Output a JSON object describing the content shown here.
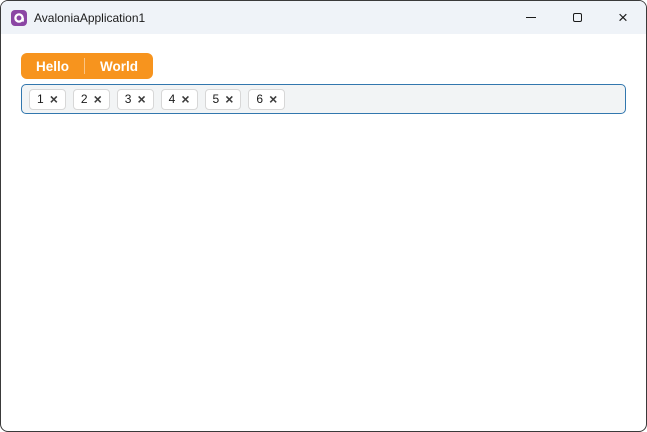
{
  "window": {
    "title": "AvaloniaApplication1",
    "app_icon": "avalonia-logo-icon",
    "controls": {
      "minimize_icon": "minimize-icon",
      "maximize_icon": "maximize-icon",
      "close_icon": "close-icon",
      "close_glyph": "×"
    }
  },
  "colors": {
    "accent-orange": "#F7941E",
    "focus-border": "#3277AE",
    "titlebar-bg": "#EFF3F8",
    "chipbox-bg": "#F2F4F5",
    "window-border": "#3A3A3A",
    "avalonia-purple": "#8B46A4"
  },
  "tabbar": {
    "items": [
      {
        "label": "Hello"
      },
      {
        "label": "World"
      }
    ]
  },
  "chips": {
    "close_glyph": "×",
    "items": [
      {
        "label": "1"
      },
      {
        "label": "2"
      },
      {
        "label": "3"
      },
      {
        "label": "4"
      },
      {
        "label": "5"
      },
      {
        "label": "6"
      }
    ]
  }
}
